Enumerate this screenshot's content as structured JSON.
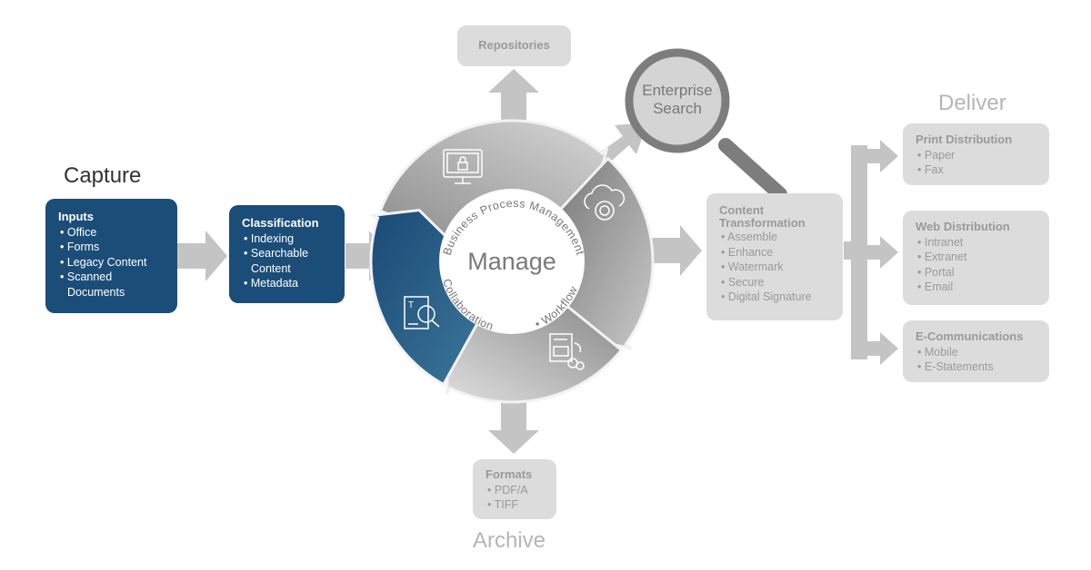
{
  "colors": {
    "blue": "#1b4d79",
    "gray_box": "#dcdcdc",
    "gray_text": "#9a9a9a",
    "arrow": "#c4c4c4"
  },
  "stages": {
    "capture": "Capture",
    "manage": "Manage",
    "deliver": "Deliver",
    "archive": "Archive"
  },
  "inputs": {
    "title": "Inputs",
    "items": [
      "Office",
      "Forms",
      "Legacy Content",
      "Scanned Documents"
    ]
  },
  "classification": {
    "title": "Classification",
    "items": [
      "Indexing",
      "Searchable Content",
      "Metadata"
    ]
  },
  "cycle": {
    "top_arc": "Business Process Management",
    "left_arc": "Collaboration",
    "right_arc": "• Workflow",
    "icons": [
      "monitor-lock-icon",
      "cloud-gear-icon",
      "document-gear-icon",
      "document-search-icon"
    ]
  },
  "repositories": "Repositories",
  "enterprise_search": "Enterprise Search",
  "content_transformation": {
    "title": "Content Transformation",
    "items": [
      "Assemble",
      "Enhance",
      "Watermark",
      "Secure",
      "Digital Signature"
    ]
  },
  "formats": {
    "title": "Formats",
    "items": [
      "PDF/A",
      "TIFF"
    ]
  },
  "deliver": [
    {
      "title": "Print Distribution",
      "items": [
        "Paper",
        "Fax"
      ]
    },
    {
      "title": "Web Distribution",
      "items": [
        "Intranet",
        "Extranet",
        "Portal",
        "Email"
      ]
    },
    {
      "title": "E-Communications",
      "items": [
        "Mobile",
        "E-Statements"
      ]
    }
  ]
}
